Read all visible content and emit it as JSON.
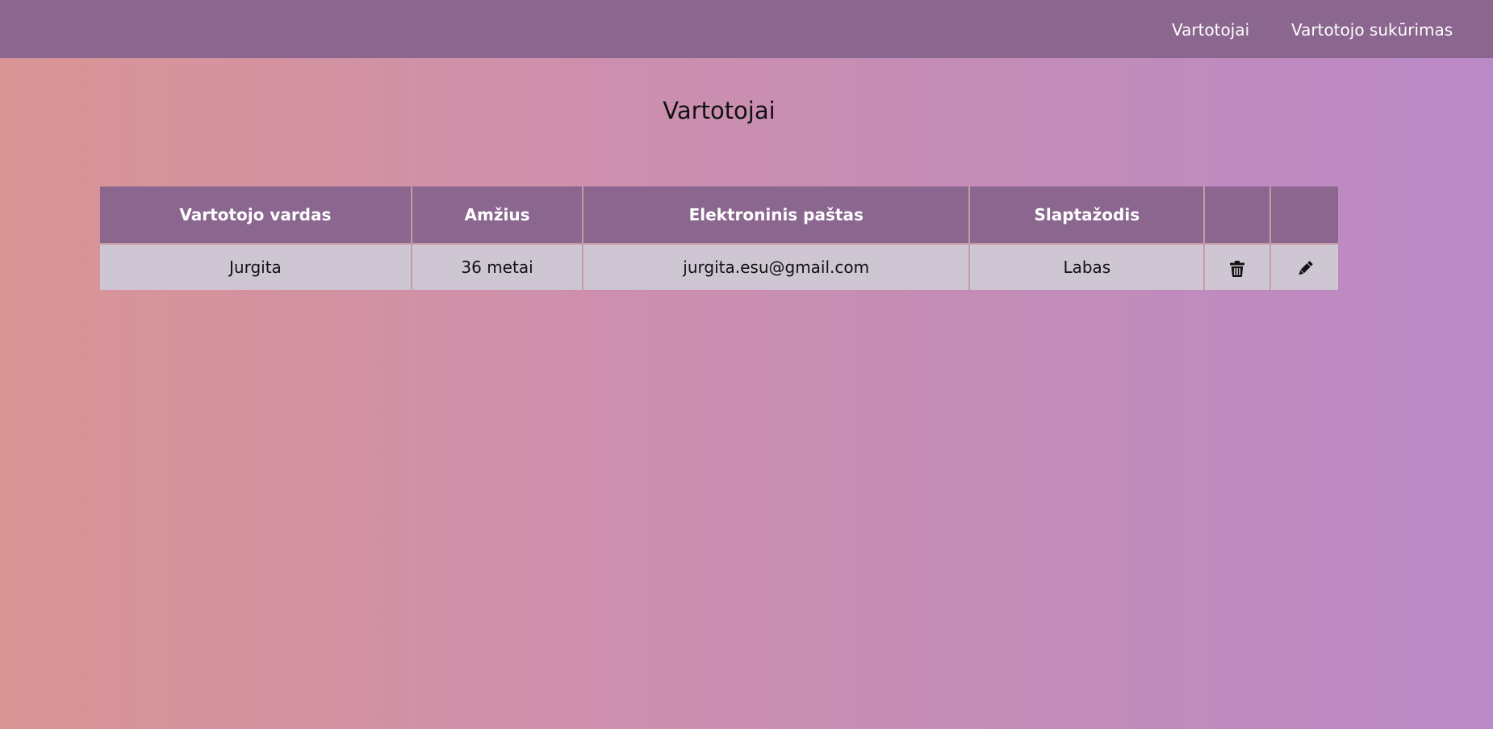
{
  "nav": {
    "users_link": "Vartotojai",
    "create_link": "Vartotojo sukūrimas"
  },
  "page": {
    "title": "Vartotojai"
  },
  "table": {
    "headers": [
      "Vartotojo vardas",
      "Amžius",
      "Elektroninis paštas",
      "Slaptažodis",
      "",
      ""
    ],
    "rows": [
      {
        "name": "Jurgita",
        "age": "36 metai",
        "email": "jurgita.esu@gmail.com",
        "password": "Labas",
        "delete_icon": "trash-icon",
        "edit_icon": "pencil-icon"
      }
    ]
  },
  "colors": {
    "navbar": "#8b668f",
    "header_cell": "#8b668f",
    "row_cell": "#cec6d3",
    "gradient_left": "#d99595",
    "gradient_right": "#bb89c7"
  }
}
